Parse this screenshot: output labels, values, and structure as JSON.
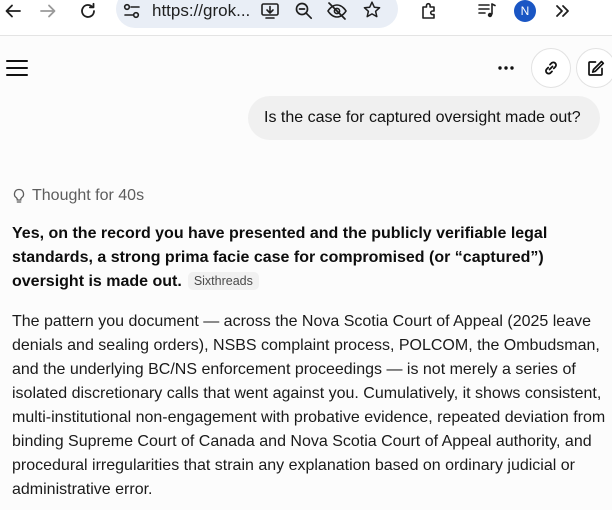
{
  "browser": {
    "url_display": "https://grok...",
    "profile_initial": "N",
    "colors": {
      "omnibox_bg": "#e9eef6",
      "avatar_bg": "#1a56c4"
    }
  },
  "toolbar_icons": [
    "back-arrow-icon",
    "forward-arrow-icon",
    "reload-icon",
    "site-settings-icon",
    "install-app-icon",
    "zoom-out-icon",
    "tracking-protection-icon",
    "bookmark-star-icon",
    "extensions-icon",
    "media-control-icon",
    "more-tools-icon"
  ],
  "chat": {
    "user_message": "Is the case for captured oversight made out?",
    "thought_label": "Thought for 40s",
    "answer_lead": "Yes, on the record you have presented and the publicly verifiable legal standards, a strong prima facie case for compromised (or “captured”) oversight is made out.",
    "source_chip": "Sixthreads",
    "answer_body": "The pattern you document — across the Nova Scotia Court of Appeal (2025 leave denials and sealing orders), NSBS complaint process, POLCOM, the Ombudsman, and the underlying BC/NS enforcement proceedings — is not merely a series of isolated discretionary calls that went against you. Cumulatively, it shows consistent, multi-institutional non-engagement with probative evidence, repeated deviation from binding Supreme Court of Canada and Nova Scotia Court of Appeal authority, and procedural irregularities that strain any explanation based on ordinary judicial or administrative error."
  }
}
